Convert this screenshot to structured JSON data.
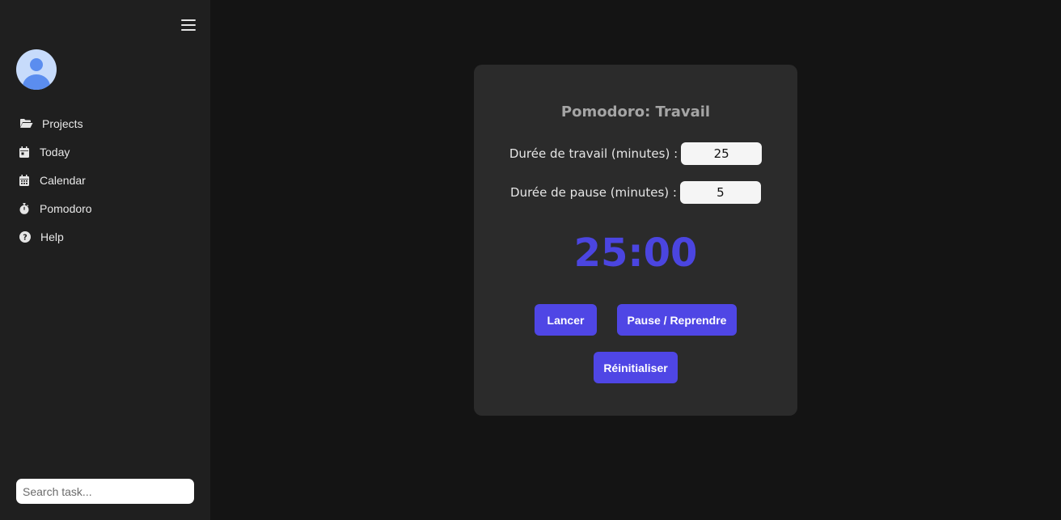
{
  "sidebar": {
    "items": [
      {
        "label": "Projects",
        "icon": "folder-open-icon"
      },
      {
        "label": "Today",
        "icon": "calendar-day-icon"
      },
      {
        "label": "Calendar",
        "icon": "calendar-icon"
      },
      {
        "label": "Pomodoro",
        "icon": "stopwatch-icon"
      },
      {
        "label": "Help",
        "icon": "question-circle-icon"
      }
    ],
    "search_placeholder": "Search task..."
  },
  "pomodoro": {
    "title": "Pomodoro: Travail",
    "work_label": "Durée de travail (minutes) :",
    "work_value": "25",
    "break_label": "Durée de pause (minutes) :",
    "break_value": "5",
    "timer": "25:00",
    "start_label": "Lancer",
    "pause_label": "Pause / Reprendre",
    "reset_label": "Réinitialiser"
  },
  "colors": {
    "accent": "#4f46e5",
    "timer": "#4b45e0",
    "sidebar_bg": "#1f1f1f",
    "page_bg": "#141414",
    "card_bg": "#2b2b2b"
  }
}
